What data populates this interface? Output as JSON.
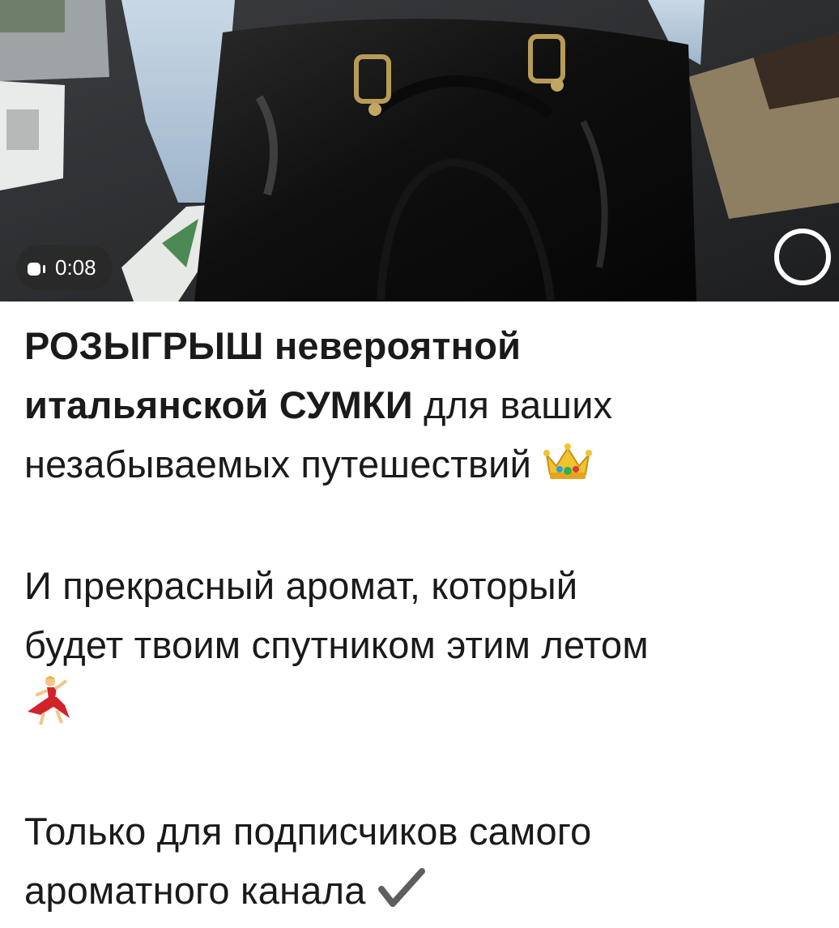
{
  "video": {
    "duration": "0:08",
    "mute_icon": "muted-video-icon",
    "play_icon": "play-ring-icon"
  },
  "caption": {
    "p1_bold1": "РОЗЫГРЫШ невероятной",
    "p1_bold2": "итальянской СУМКИ",
    "p1_rest1": " для ваших",
    "p1_rest2": "незабываемых путешествий",
    "p1_emoji": "crown-emoji",
    "p2_line1": "И прекрасный аромат, который",
    "p2_line2": "будет твоим спутником этим летом",
    "p2_emoji": "dancing-woman-emoji",
    "p3_line1": "Только для подписчиков самого",
    "p3_line2": "ароматного канала",
    "p3_emoji": "check-mark-emoji"
  },
  "colors": {
    "text": "#1a1a1a",
    "background": "#ffffff",
    "pill_bg": "#282828"
  }
}
